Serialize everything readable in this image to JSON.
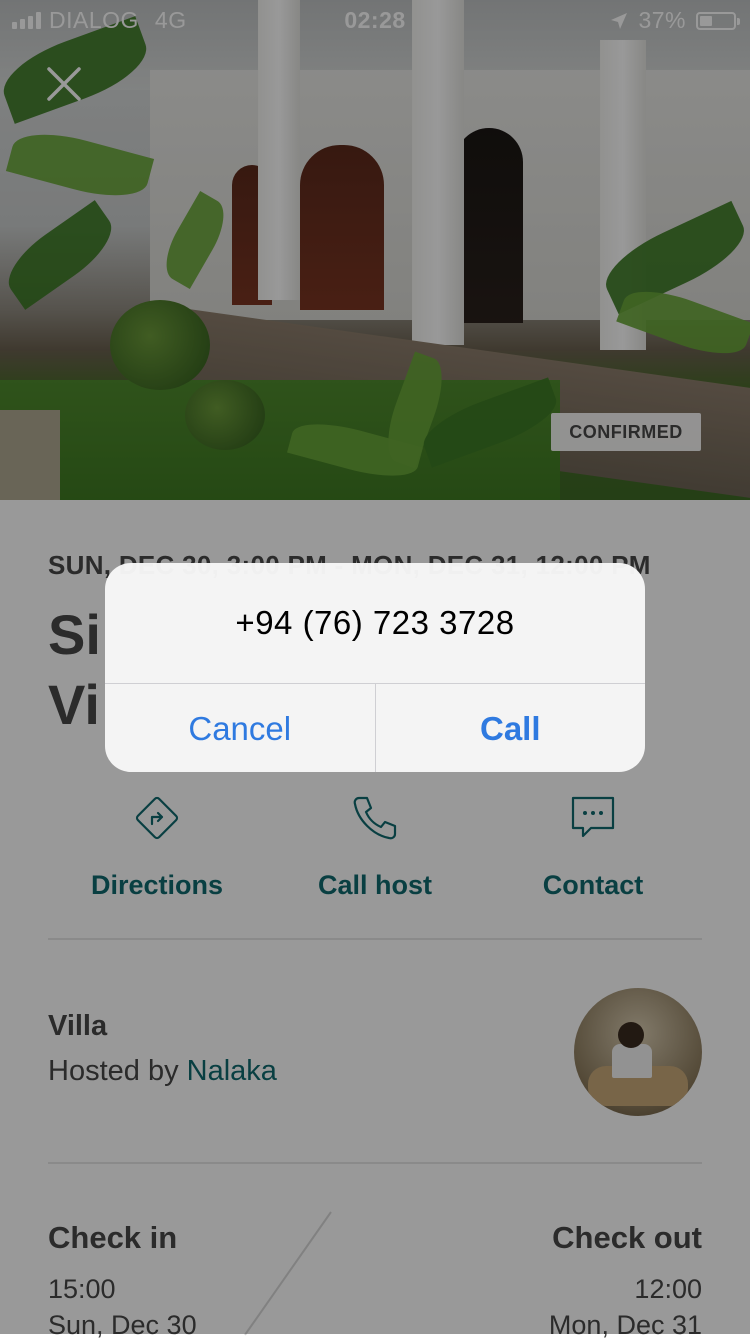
{
  "status_bar": {
    "carrier": "DIALOG",
    "network": "4G",
    "time": "02:28",
    "battery": "37%",
    "battery_level": 0.37
  },
  "hero": {
    "badge": "CONFIRMED"
  },
  "reservation": {
    "dates": "SUN, DEC 30, 3:00 PM - MON, DEC 31, 12:00 PM",
    "title_visible": "Si\nVi"
  },
  "actions": [
    {
      "label": "Directions",
      "icon": "directions-icon"
    },
    {
      "label": "Call host",
      "icon": "phone-icon"
    },
    {
      "label": "Contact",
      "icon": "chat-icon"
    }
  ],
  "host": {
    "type": "Villa",
    "hosted_prefix": "Hosted by ",
    "name": "Nalaka"
  },
  "check": {
    "in_label": "Check in",
    "out_label": "Check out",
    "in_time": "15:00",
    "out_time": "12:00",
    "in_date": "Sun, Dec 30",
    "out_date": "Mon, Dec 31"
  },
  "alert": {
    "message": "+94 (76) 723 3728",
    "cancel": "Cancel",
    "call": "Call"
  },
  "colors": {
    "teal": "#0f6a6e",
    "ios_blue": "#2f7ae0",
    "text": "#484848"
  }
}
